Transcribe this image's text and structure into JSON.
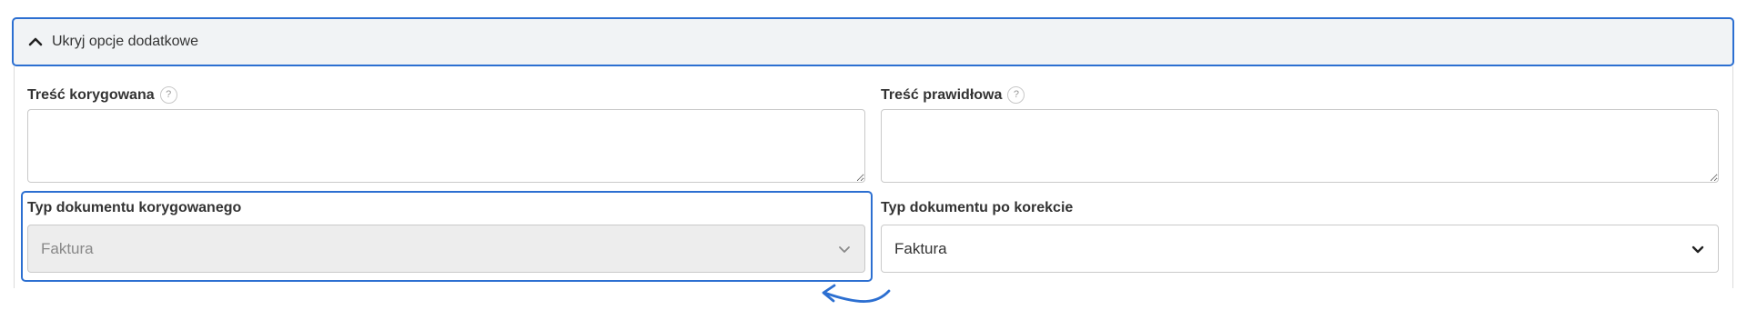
{
  "panel": {
    "title": "Ukryj opcje dodatkowe",
    "icon": "chevron-up-icon",
    "border_color": "#2c6fd1"
  },
  "fields": {
    "corrected_content": {
      "label": "Treść korygowana",
      "help": "?",
      "value": ""
    },
    "correct_content": {
      "label": "Treść prawidłowa",
      "help": "?",
      "value": ""
    },
    "corrected_doc_type": {
      "label": "Typ dokumentu korygowanego",
      "value": "Faktura",
      "disabled": true
    },
    "post_correction_doc_type": {
      "label": "Typ dokumentu po korekcie",
      "value": "Faktura",
      "disabled": false
    }
  },
  "annotation": {
    "icon": "curved-arrow-icon",
    "color": "#2c6fd1"
  }
}
